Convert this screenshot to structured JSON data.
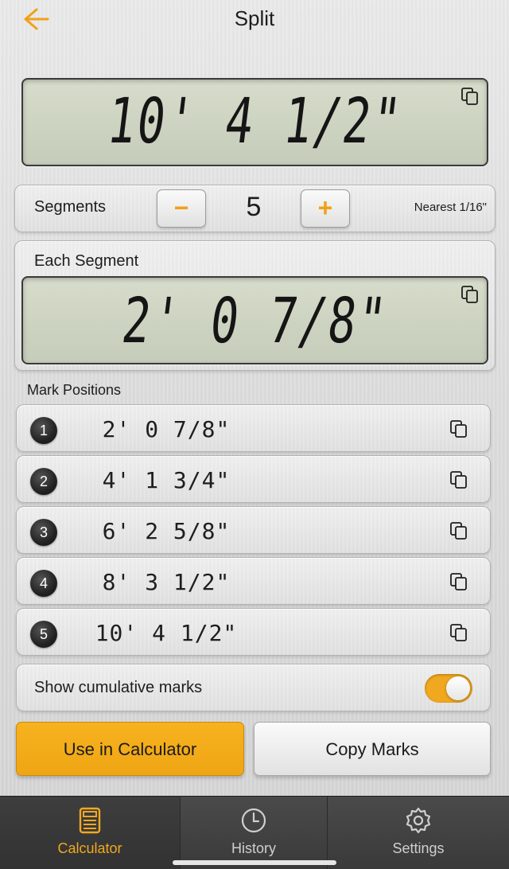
{
  "header": {
    "title": "Split"
  },
  "total_display": {
    "value": "10' 4 1/2\""
  },
  "segments": {
    "label": "Segments",
    "count": "5",
    "minus": "−",
    "plus": "+",
    "rounding": "Nearest 1/16\""
  },
  "each_segment": {
    "label": "Each Segment",
    "value": "2' 0 7/8\""
  },
  "marks": {
    "label": "Mark Positions",
    "items": [
      {
        "number": "1",
        "value": "2' 0 7/8\""
      },
      {
        "number": "2",
        "value": "4' 1 3/4\""
      },
      {
        "number": "3",
        "value": "6' 2 5/8\""
      },
      {
        "number": "4",
        "value": "8' 3 1/2\""
      },
      {
        "number": "5",
        "value": "10' 4 1/2\""
      }
    ]
  },
  "cumulative": {
    "label": "Show cumulative marks",
    "enabled": true
  },
  "actions": {
    "primary": "Use in Calculator",
    "secondary": "Copy Marks"
  },
  "tabs": [
    {
      "label": "Calculator",
      "icon": "calculator-icon",
      "active": true
    },
    {
      "label": "History",
      "icon": "clock-icon",
      "active": false
    },
    {
      "label": "Settings",
      "icon": "gear-icon",
      "active": false
    }
  ],
  "colors": {
    "accent": "#F0A820",
    "lcd": "#CDD3C1",
    "tabbar": "#3A3A3A"
  }
}
